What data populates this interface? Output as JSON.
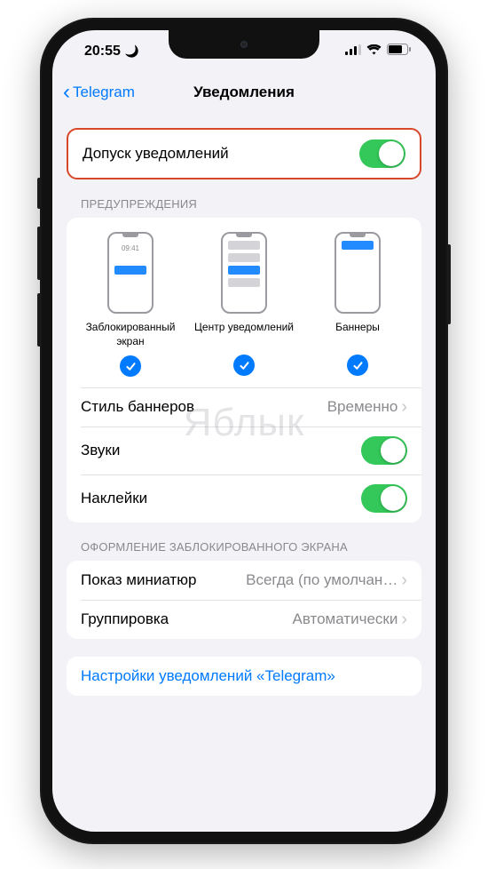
{
  "status": {
    "time": "20:55",
    "moon": true
  },
  "nav": {
    "back_label": "Telegram",
    "title": "Уведомления"
  },
  "allow": {
    "label": "Допуск уведомлений",
    "on": true
  },
  "alerts": {
    "header": "ПРЕДУПРЕЖДЕНИЯ",
    "lock_time": "09:41",
    "options": [
      {
        "label": "Заблокированный экран",
        "checked": true
      },
      {
        "label": "Центр уведомлений",
        "checked": true
      },
      {
        "label": "Баннеры",
        "checked": true
      }
    ],
    "banner_style": {
      "label": "Стиль баннеров",
      "value": "Временно"
    },
    "sounds": {
      "label": "Звуки",
      "on": true
    },
    "badges": {
      "label": "Наклейки",
      "on": true
    }
  },
  "lockscreen": {
    "header": "ОФОРМЛЕНИЕ ЗАБЛОКИРОВАННОГО ЭКРАНА",
    "previews": {
      "label": "Показ миниатюр",
      "value": "Всегда (по умолчан…"
    },
    "grouping": {
      "label": "Группировка",
      "value": "Автоматически"
    }
  },
  "app_link": {
    "label": "Настройки уведомлений «Telegram»"
  },
  "watermark": "Яблык"
}
